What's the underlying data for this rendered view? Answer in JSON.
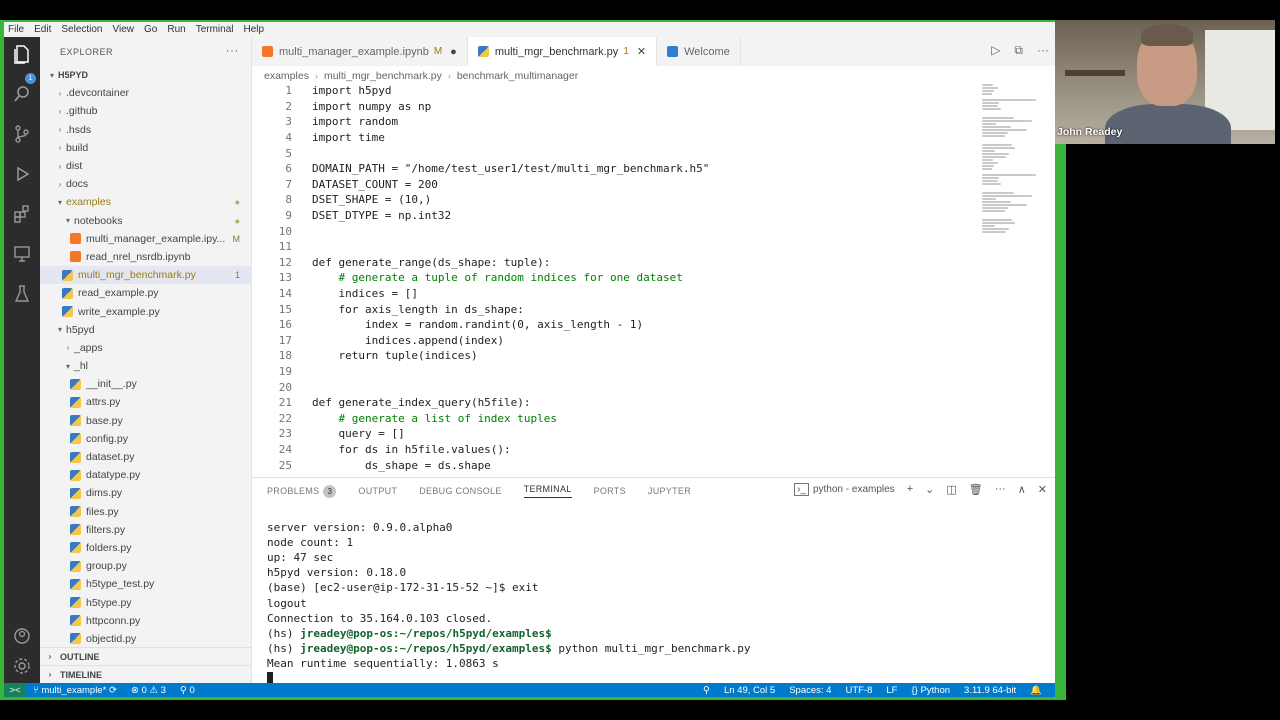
{
  "menubar": [
    "File",
    "Edit",
    "Selection",
    "View",
    "Go",
    "Run",
    "Terminal",
    "Help"
  ],
  "activity_icons": [
    "files-icon",
    "search-icon",
    "source-control-icon",
    "run-debug-icon",
    "extensions-icon",
    "remote-explorer-icon",
    "testing-icon"
  ],
  "activity_badge": "1",
  "sidebar": {
    "header": "EXPLORER",
    "more": "···",
    "root": "H5PYD",
    "items": [
      {
        "label": ".devcontainer",
        "kind": "folder",
        "depth": 1,
        "expanded": false,
        "deco": ""
      },
      {
        "label": ".github",
        "kind": "folder",
        "depth": 1,
        "expanded": false,
        "deco": ""
      },
      {
        "label": ".hsds",
        "kind": "folder",
        "depth": 1,
        "expanded": false,
        "deco": ""
      },
      {
        "label": "build",
        "kind": "folder",
        "depth": 1,
        "expanded": false,
        "deco": ""
      },
      {
        "label": "dist",
        "kind": "folder",
        "depth": 1,
        "expanded": false,
        "deco": ""
      },
      {
        "label": "docs",
        "kind": "folder",
        "depth": 1,
        "expanded": false,
        "deco": ""
      },
      {
        "label": "examples",
        "kind": "folder",
        "depth": 1,
        "expanded": true,
        "deco": "●",
        "modified": true
      },
      {
        "label": "notebooks",
        "kind": "folder",
        "depth": 2,
        "expanded": true,
        "deco": "●"
      },
      {
        "label": "multi_manager_example.ipy...",
        "kind": "notebook",
        "depth": 3,
        "deco": "M"
      },
      {
        "label": "read_nrel_nsrdb.ipynb",
        "kind": "notebook",
        "depth": 3,
        "deco": ""
      },
      {
        "label": "multi_mgr_benchmark.py",
        "kind": "python",
        "depth": 2,
        "deco": "1",
        "selected": true,
        "modified": true
      },
      {
        "label": "read_example.py",
        "kind": "python",
        "depth": 2,
        "deco": ""
      },
      {
        "label": "write_example.py",
        "kind": "python",
        "depth": 2,
        "deco": ""
      },
      {
        "label": "h5pyd",
        "kind": "folder",
        "depth": 1,
        "expanded": true,
        "deco": ""
      },
      {
        "label": "_apps",
        "kind": "folder",
        "depth": 2,
        "expanded": false,
        "deco": ""
      },
      {
        "label": "_hl",
        "kind": "folder",
        "depth": 2,
        "expanded": true,
        "deco": ""
      },
      {
        "label": "__init__.py",
        "kind": "python",
        "depth": 3,
        "deco": ""
      },
      {
        "label": "attrs.py",
        "kind": "python",
        "depth": 3,
        "deco": ""
      },
      {
        "label": "base.py",
        "kind": "python",
        "depth": 3,
        "deco": ""
      },
      {
        "label": "config.py",
        "kind": "python",
        "depth": 3,
        "deco": ""
      },
      {
        "label": "dataset.py",
        "kind": "python",
        "depth": 3,
        "deco": ""
      },
      {
        "label": "datatype.py",
        "kind": "python",
        "depth": 3,
        "deco": ""
      },
      {
        "label": "dims.py",
        "kind": "python",
        "depth": 3,
        "deco": ""
      },
      {
        "label": "files.py",
        "kind": "python",
        "depth": 3,
        "deco": ""
      },
      {
        "label": "filters.py",
        "kind": "python",
        "depth": 3,
        "deco": ""
      },
      {
        "label": "folders.py",
        "kind": "python",
        "depth": 3,
        "deco": ""
      },
      {
        "label": "group.py",
        "kind": "python",
        "depth": 3,
        "deco": ""
      },
      {
        "label": "h5type_test.py",
        "kind": "python",
        "depth": 3,
        "deco": ""
      },
      {
        "label": "h5type.py",
        "kind": "python",
        "depth": 3,
        "deco": ""
      },
      {
        "label": "httpconn.py",
        "kind": "python",
        "depth": 3,
        "deco": ""
      },
      {
        "label": "objectid.py",
        "kind": "python",
        "depth": 3,
        "deco": ""
      }
    ],
    "outline": "OUTLINE",
    "timeline": "TIMELINE"
  },
  "tabs": [
    {
      "label": "multi_manager_example.ipynb",
      "deco": "M",
      "dirty": "●",
      "kind": "notebook",
      "active": false
    },
    {
      "label": "multi_mgr_benchmark.py",
      "deco": "1",
      "close": "✕",
      "kind": "python",
      "active": true
    },
    {
      "label": "Welcome",
      "kind": "vscode",
      "active": false
    }
  ],
  "tab_actions": [
    "▷",
    "⧉",
    "···"
  ],
  "breadcrumb": [
    "examples",
    "multi_mgr_benchmark.py",
    "benchmark_multimanager"
  ],
  "code": [
    {
      "n": "1",
      "t": "import h5pyd"
    },
    {
      "n": "2",
      "t": "import numpy as np"
    },
    {
      "n": "3",
      "t": "import random"
    },
    {
      "n": "4",
      "t": "import time"
    },
    {
      "n": "5",
      "t": ""
    },
    {
      "n": "6",
      "t": "DOMAIN_PATH = \"/home/test_user1/test/multi_mgr_benchmark.h5\""
    },
    {
      "n": "7",
      "t": "DATASET_COUNT = 200"
    },
    {
      "n": "8",
      "t": "DSET_SHAPE = (10,)"
    },
    {
      "n": "9",
      "t": "DSET_DTYPE = np.int32"
    },
    {
      "n": "10",
      "t": ""
    },
    {
      "n": "11",
      "t": ""
    },
    {
      "n": "12",
      "t": "def generate_range(ds_shape: tuple):"
    },
    {
      "n": "13",
      "t": "    # generate a tuple of random indices for one dataset"
    },
    {
      "n": "14",
      "t": "    indices = []"
    },
    {
      "n": "15",
      "t": "    for axis_length in ds_shape:"
    },
    {
      "n": "16",
      "t": "        index = random.randint(0, axis_length - 1)"
    },
    {
      "n": "17",
      "t": "        indices.append(index)"
    },
    {
      "n": "18",
      "t": "    return tuple(indices)"
    },
    {
      "n": "19",
      "t": ""
    },
    {
      "n": "20",
      "t": ""
    },
    {
      "n": "21",
      "t": "def generate_index_query(h5file):"
    },
    {
      "n": "22",
      "t": "    # generate a list of index tuples"
    },
    {
      "n": "23",
      "t": "    query = []"
    },
    {
      "n": "24",
      "t": "    for ds in h5file.values():"
    },
    {
      "n": "25",
      "t": "        ds_shape = ds.shape"
    }
  ],
  "panel": {
    "tabs": [
      {
        "label": "PROBLEMS",
        "badge": "3"
      },
      {
        "label": "OUTPUT"
      },
      {
        "label": "DEBUG CONSOLE"
      },
      {
        "label": "TERMINAL",
        "active": true
      },
      {
        "label": "PORTS"
      },
      {
        "label": "JUPYTER"
      }
    ],
    "terminal_name": "python - examples",
    "actions": [
      "+",
      "⌄",
      "◫",
      "🗑",
      "···",
      "∧",
      "✕"
    ]
  },
  "terminal": [
    {
      "text": "server version: 0.9.0.alpha0"
    },
    {
      "text": "node count: 1"
    },
    {
      "text": "up: 47 sec"
    },
    {
      "text": "h5pyd version: 0.18.0"
    },
    {
      "text": "(base) [ec2-user@ip-172-31-15-52 ~]$ exit"
    },
    {
      "text": "logout"
    },
    {
      "text": "Connection to 35.164.0.103 closed."
    },
    {
      "prefix": "(hs) ",
      "prompt": "jreadey@pop-os:~/repos/h5pyd/examples$",
      "text": ""
    },
    {
      "prefix": "(hs) ",
      "prompt": "jreadey@pop-os:~/repos/h5pyd/examples$",
      "text": " python multi_mgr_benchmark.py"
    },
    {
      "text": "Mean runtime sequentially: 1.0863 s"
    }
  ],
  "statusbar": {
    "remote": "><",
    "branch": "multi_example*",
    "sync": "⟳",
    "problems": "⊗ 0 ⚠ 3",
    "ports": "⚲ 0",
    "zoom": "⚲",
    "position": "Ln 49, Col 5",
    "spaces": "Spaces: 4",
    "encoding": "UTF-8",
    "eol": "LF",
    "language": "{} Python",
    "interpreter": "3.11.9 64-bit",
    "bell": "🔔"
  },
  "webcam": {
    "name": "John Readey"
  }
}
